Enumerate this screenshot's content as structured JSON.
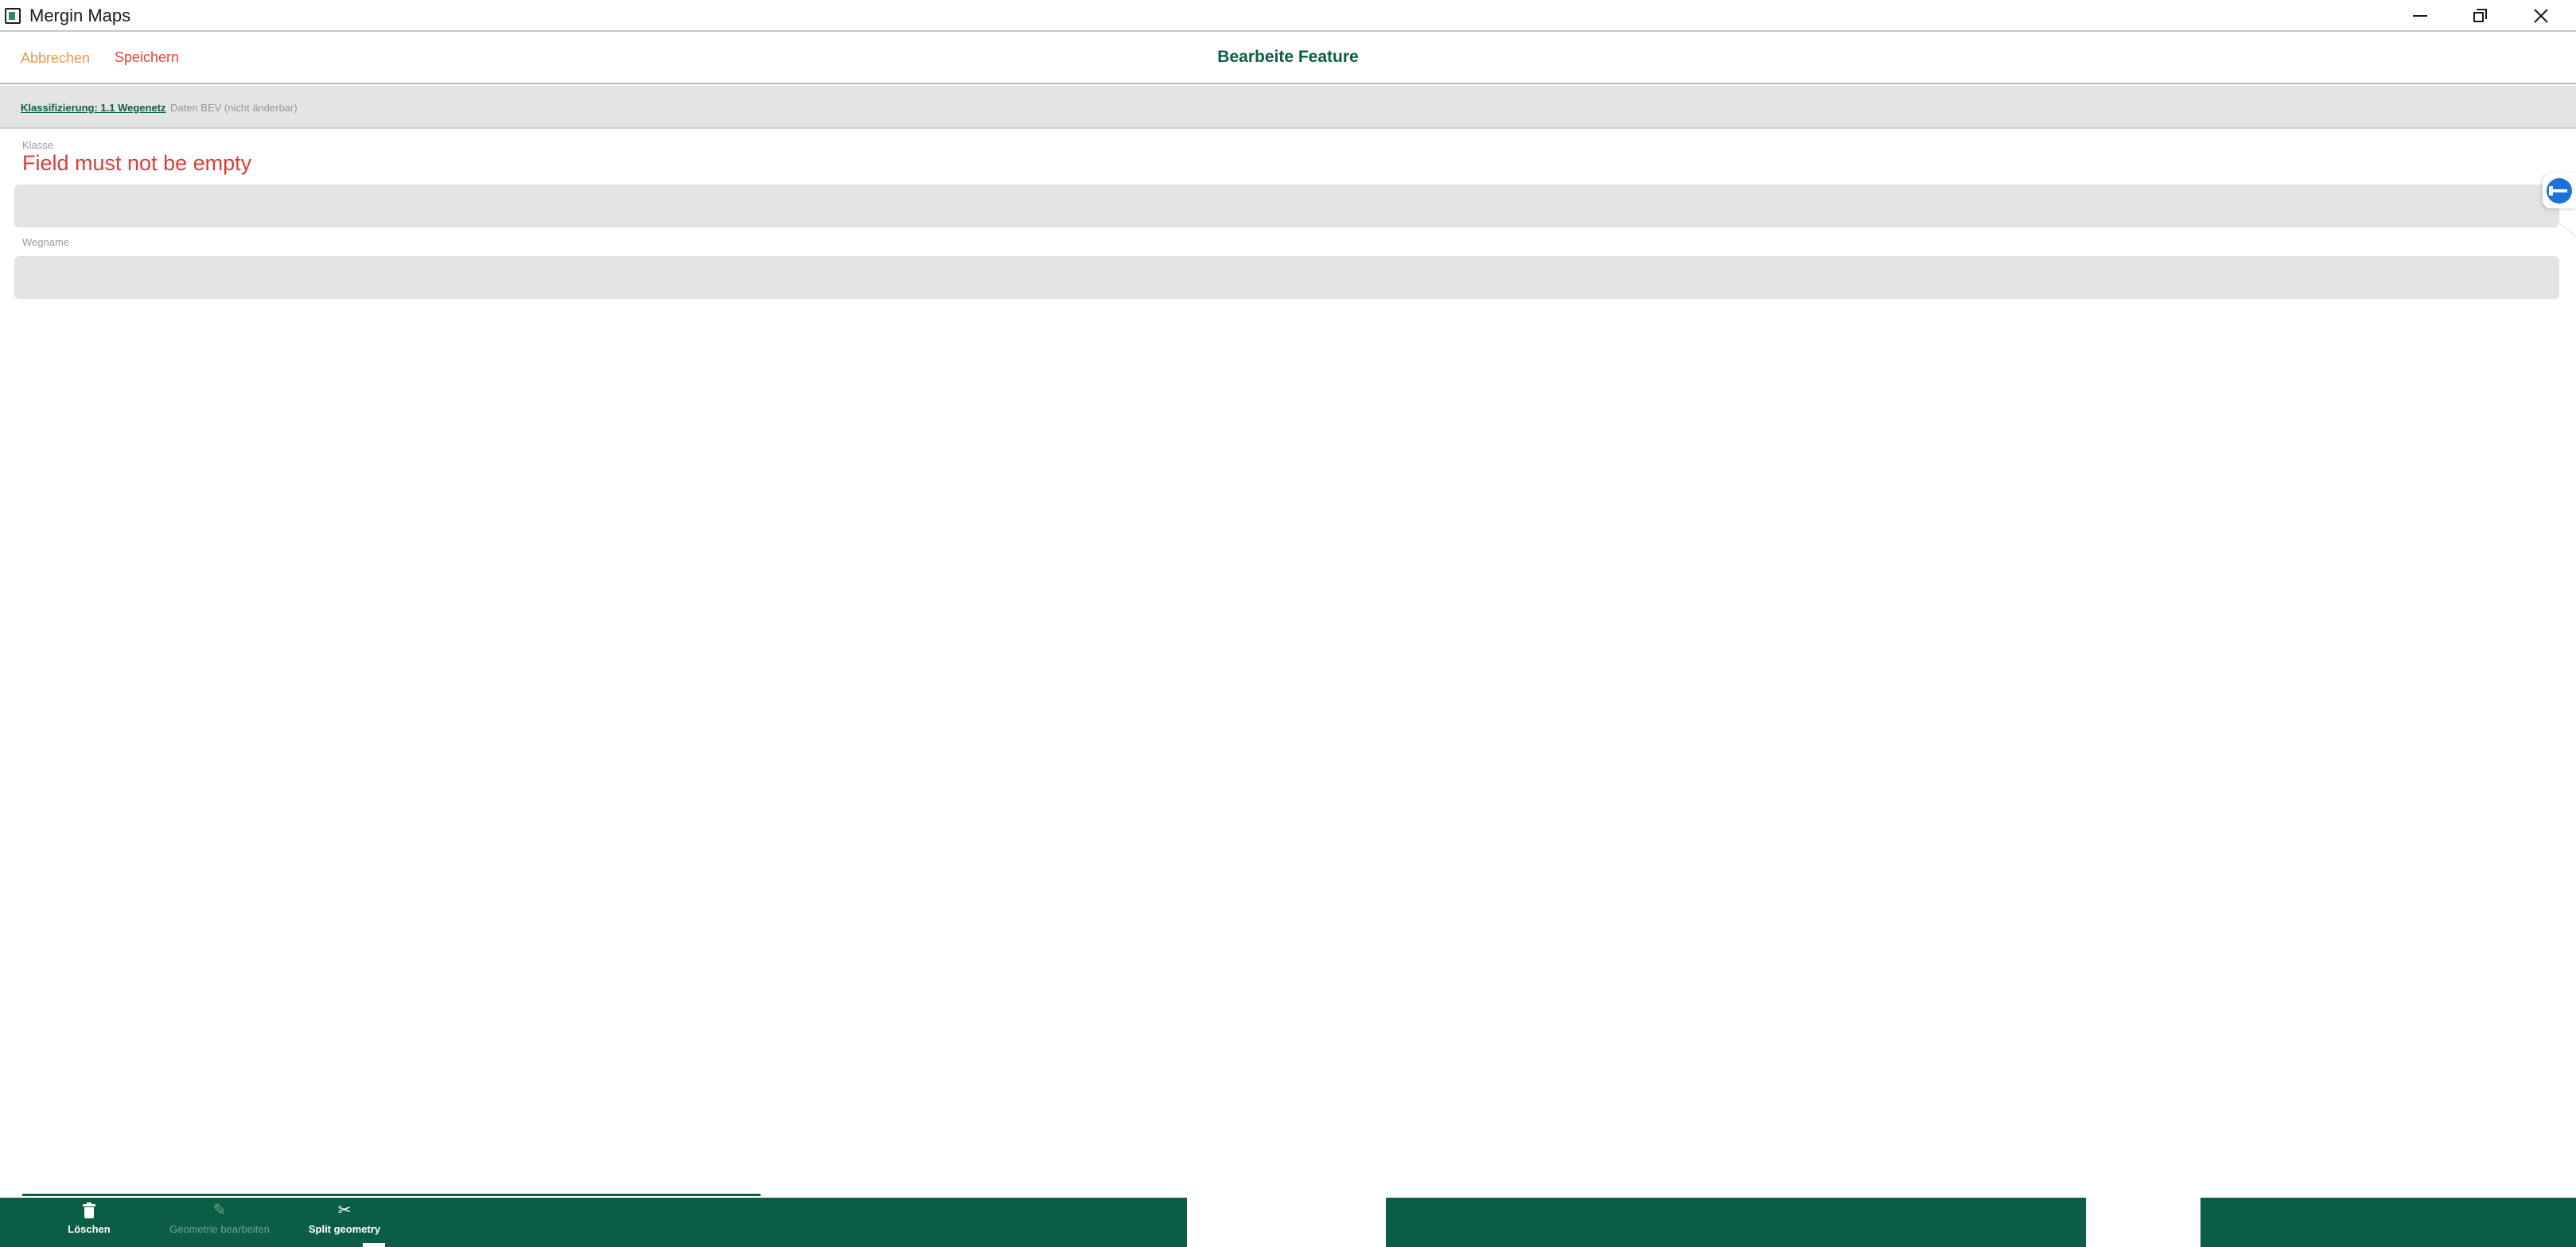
{
  "window": {
    "title": "Mergin Maps"
  },
  "header": {
    "cancel_label": "Abbrechen",
    "save_label": "Speichern",
    "title": "Bearbeite Feature"
  },
  "tabs": [
    {
      "label": "Klassifizierung: 1.1 Wegenetz",
      "active": true
    },
    {
      "label": "Daten BEV (nicht änderbar)",
      "active": false
    }
  ],
  "form": {
    "klasse": {
      "label": "Klasse",
      "error": "Field must not be empty",
      "value": ""
    },
    "wegname": {
      "label": "Wegname",
      "value": ""
    }
  },
  "toolbar": {
    "delete_label": "Löschen",
    "edit_geometry_label": "Geometrie bearbeiten",
    "split_geometry_label": "Split geometry"
  },
  "colors": {
    "brand_green": "#0b5e45",
    "cancel_orange": "#f2944a",
    "save_red": "#e6403d",
    "error_red": "#d93d3a"
  },
  "icons": {
    "delete": "trash-icon",
    "edit_geometry": "pencil-icon",
    "split_geometry": "scissors-icon",
    "side_handle": "remote-control-icon"
  }
}
